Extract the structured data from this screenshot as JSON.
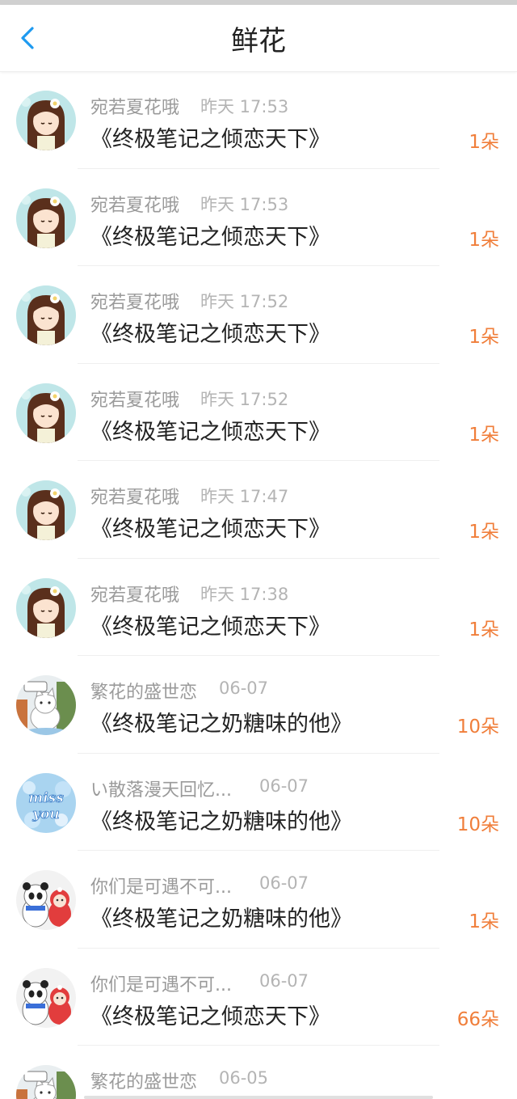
{
  "header": {
    "title": "鲜花"
  },
  "items": [
    {
      "name": "宛若夏花哦",
      "time": "昨天 17:53",
      "book": "《终极笔记之倾恋天下》",
      "count": "1朵",
      "avatar": "girl"
    },
    {
      "name": "宛若夏花哦",
      "time": "昨天 17:53",
      "book": "《终极笔记之倾恋天下》",
      "count": "1朵",
      "avatar": "girl"
    },
    {
      "name": "宛若夏花哦",
      "time": "昨天 17:52",
      "book": "《终极笔记之倾恋天下》",
      "count": "1朵",
      "avatar": "girl"
    },
    {
      "name": "宛若夏花哦",
      "time": "昨天 17:52",
      "book": "《终极笔记之倾恋天下》",
      "count": "1朵",
      "avatar": "girl"
    },
    {
      "name": "宛若夏花哦",
      "time": "昨天 17:47",
      "book": "《终极笔记之倾恋天下》",
      "count": "1朵",
      "avatar": "girl"
    },
    {
      "name": "宛若夏花哦",
      "time": "昨天 17:38",
      "book": "《终极笔记之倾恋天下》",
      "count": "1朵",
      "avatar": "girl"
    },
    {
      "name": "繁花的盛世恋",
      "time": "06-07",
      "book": "《终极笔记之奶糖味的他》",
      "count": "10朵",
      "avatar": "cat"
    },
    {
      "name": "い散落漫天回忆...",
      "time": "06-07",
      "book": "《终极笔记之奶糖味的他》",
      "count": "10朵",
      "avatar": "missyou"
    },
    {
      "name": "你们是可遇不可...",
      "time": "06-07",
      "book": "《终极笔记之奶糖味的他》",
      "count": "1朵",
      "avatar": "panda"
    },
    {
      "name": "你们是可遇不可...",
      "time": "06-07",
      "book": "《终极笔记之倾恋天下》",
      "count": "66朵",
      "avatar": "panda"
    },
    {
      "name": "繁花的盛世恋",
      "time": "06-05",
      "book": "",
      "count": "",
      "avatar": "cat"
    }
  ],
  "avatar_texts": {
    "missyou": "miss you"
  },
  "colors": {
    "accent": "#f07e3a",
    "back": "#1e9af0"
  }
}
